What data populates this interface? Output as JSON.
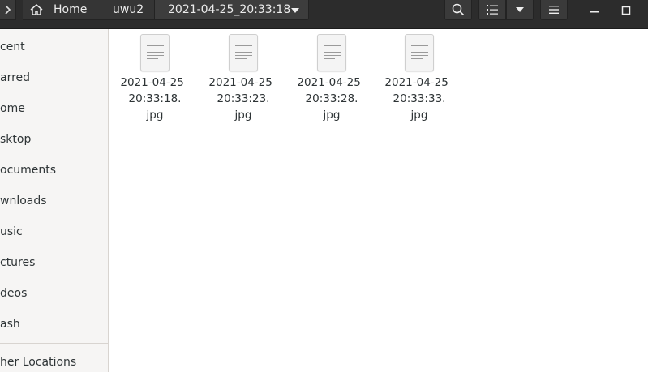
{
  "header": {
    "back_icon": "chevron-right-icon",
    "breadcrumbs": [
      {
        "label": "Home",
        "icon": "home-icon"
      },
      {
        "label": "uwu2"
      },
      {
        "label": "2021-04-25_20:33:18"
      }
    ],
    "breadcrumb_menu_icon": "triangle-down-icon",
    "search_icon": "search-icon",
    "view_list_icon": "list-view-icon",
    "view_options_icon": "triangle-down-icon",
    "menu_icon": "hamburger-icon",
    "minimize_icon": "minimize-icon",
    "maximize_icon": "maximize-icon"
  },
  "sidebar": {
    "items": [
      {
        "label": "cent"
      },
      {
        "label": "arred"
      },
      {
        "label": "ome"
      },
      {
        "label": "sktop"
      },
      {
        "label": "ocuments"
      },
      {
        "label": "wnloads"
      },
      {
        "label": "usic"
      },
      {
        "label": "ctures"
      },
      {
        "label": "deos"
      },
      {
        "label": "ash"
      }
    ],
    "other_locations": "her Locations"
  },
  "files": [
    {
      "name": "2021-04-25_20:33:18.jpg",
      "line1": "2021-04-25_",
      "line2": "20:33:18.",
      "line3": "jpg",
      "icon": "document-icon"
    },
    {
      "name": "2021-04-25_20:33:23.jpg",
      "line1": "2021-04-25_",
      "line2": "20:33:23.",
      "line3": "jpg",
      "icon": "document-icon"
    },
    {
      "name": "2021-04-25_20:33:28.jpg",
      "line1": "2021-04-25_",
      "line2": "20:33:28.",
      "line3": "jpg",
      "icon": "document-icon"
    },
    {
      "name": "2021-04-25_20:33:33.jpg",
      "line1": "2021-04-25_",
      "line2": "20:33:33.",
      "line3": "jpg",
      "icon": "document-icon"
    }
  ]
}
